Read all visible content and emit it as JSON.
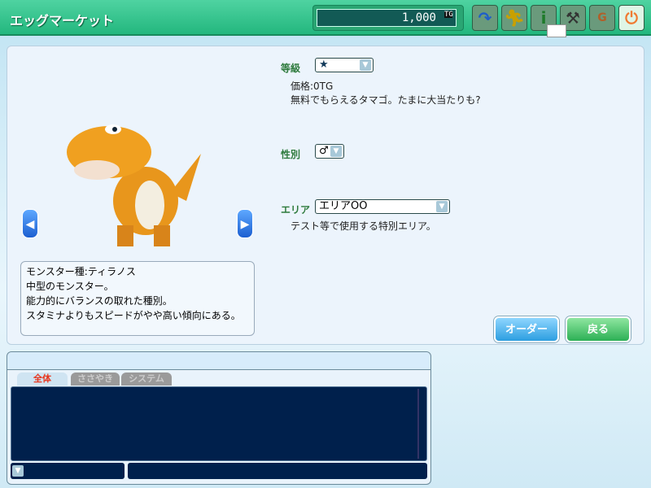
{
  "window": {
    "title": "エッグマーケット"
  },
  "header": {
    "money": "1,000",
    "currency": "TG",
    "icons": [
      "return-icon",
      "run-icon",
      "info-icon",
      "wrench-icon",
      "money-bag-icon",
      "power-icon"
    ],
    "mail": "mail-icon"
  },
  "form": {
    "grade_label": "等級",
    "grade_value": "★",
    "price": "価格:0TG",
    "grade_desc": "無料でもらえるタマゴ。たまに大当たりも?",
    "gender_label": "性別",
    "gender_value": "♂",
    "area_label": "エリア",
    "area_value": "エリアOO",
    "area_desc": "テスト等で使用する特別エリア。"
  },
  "monster": {
    "desc": [
      "モンスター種:ティラノス",
      "中型のモンスター。",
      "能力的にバランスの取れた種別。",
      "スタミナよりもスピードがやや高い傾向にある。"
    ]
  },
  "buttons": {
    "order": "オーダー",
    "back": "戻る"
  },
  "chat": {
    "tabs": [
      "全体",
      "ささやき",
      "システム"
    ]
  }
}
